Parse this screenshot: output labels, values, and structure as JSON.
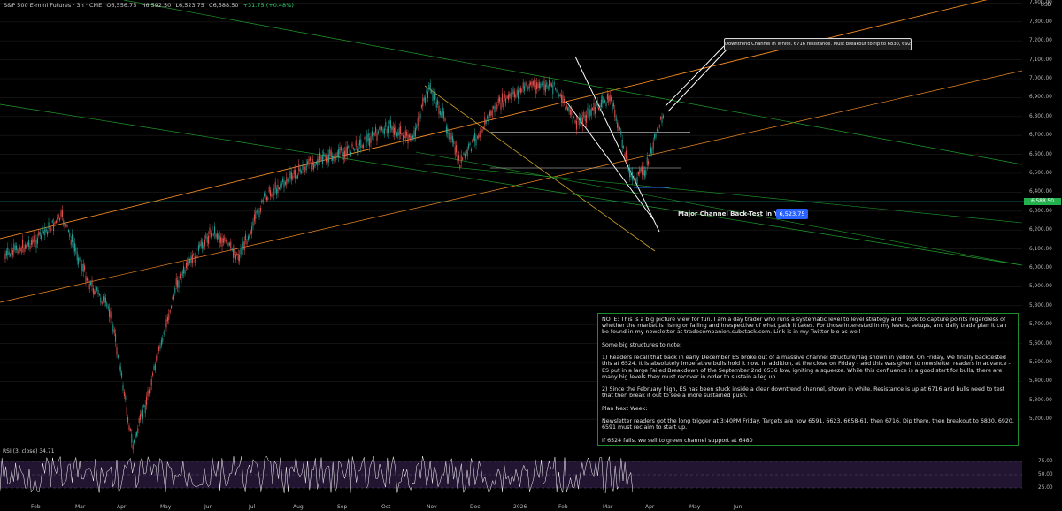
{
  "header": {
    "symbol": "S&P 500 E-mini Futures · 3h · CME",
    "open": "O6,556.75",
    "high": "H6,592.50",
    "low": "L6,523.75",
    "close": "C6,588.50",
    "change": "+31.75 (+0.48%)"
  },
  "currency": "USD",
  "last_price": "6,588.50",
  "y_axis": [
    "7,400.00",
    "7,300.00",
    "7,200.00",
    "7,100.00",
    "7,000.00",
    "6,900.00",
    "6,800.00",
    "6,700.00",
    "6,600.00",
    "6,500.00",
    "6,400.00",
    "6,300.00",
    "6,200.00",
    "6,100.00",
    "6,000.00",
    "5,900.00",
    "5,800.00",
    "5,700.00",
    "5,600.00",
    "5,500.00",
    "5,400.00",
    "5,300.00",
    "5,200.00"
  ],
  "x_axis": [
    "Feb",
    "Mar",
    "Apr",
    "May",
    "Jun",
    "Jul",
    "Aug",
    "Sep",
    "Oct",
    "Nov",
    "Dec",
    "2026",
    "Feb",
    "Mar",
    "Apr",
    "May",
    "Jun"
  ],
  "annotations": {
    "callout": "Downtrend Channel in White. 6716 resistance. Must breakout to rip to 6830, 6920+",
    "back_test_label": "Major Channel Back-Test In Yellow",
    "back_test_price": "6,523.75"
  },
  "rsi": {
    "title": "RSI (3, close)  34.71",
    "levels": [
      "75.00",
      "50.00",
      "25.00"
    ]
  },
  "note": {
    "p1": "NOTE: This is a big picture view for fun. I am a day trader who runs a systematic level to level strategy and I look to capture points regardless of whether the market is rising or falling and irrespective of what path it takes. For those interested in my levels, setups, and daily trade plan it can be found in my newsletter at tradecompanion.substack.com. Link is in my Twitter bio as well",
    "p2": "Some big structures to note:",
    "p3": "1) Readers recall that back in early December ES broke out of a massive channel structure/flag shown in yellow. On Friday, we finally backtested this at 6524. It is absolutely imperative bulls hold it now. In addition, at the close on Friday - and this was given to newsletter readers in advance - ES put in a large Failed Breakdown of the September 2nd 6536 low, igniting a squeeze. While this confluence is a good start for bulls, there are many big levels they must recover in order to sustain a leg up.",
    "p4": "2) Since the February high, ES has been stuck inside a clear downtrend channel, shown in white. Resistance is up at 6716 and bulls need to test that then break it out to see a more sustained push.",
    "p5": "Plan Next Week:",
    "p6": "Newsletter readers got the long trigger at 3:40PM Friday. Targets are now 6591, 6623, 6658-61, then 6716. Dip there, then breakout to 6830, 6920. 6591 must reclaim to start up.",
    "p7": "If 6524 fails, we sell to green channel support at 6480"
  },
  "colors": {
    "up": "#26a69a",
    "down": "#ef5350",
    "orange_channel": "#f08a24",
    "yellow_channel": "#c9a227",
    "green_channel": "#1f9d2a",
    "white_channel": "#ffffff",
    "rsi_band": "#2a1a3d",
    "rsi_line": "#ffffff"
  }
}
